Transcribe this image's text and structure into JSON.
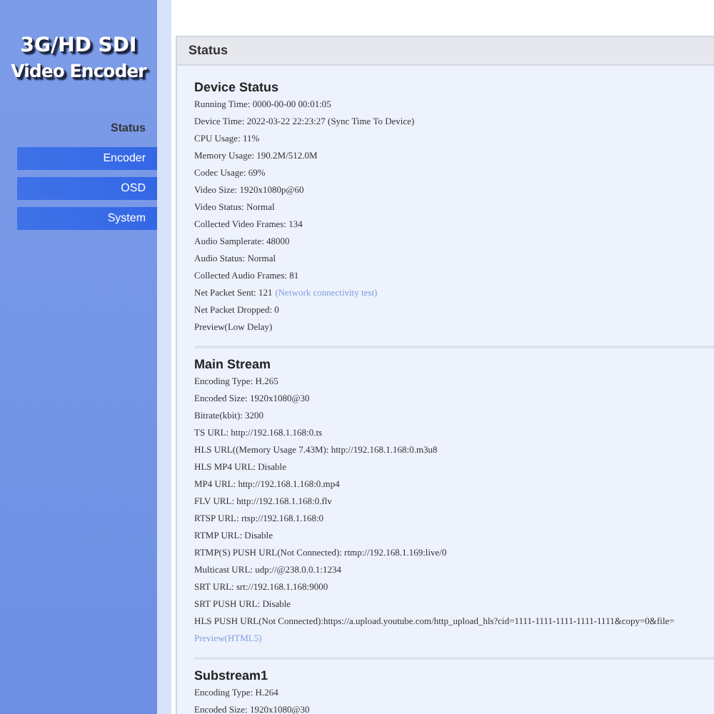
{
  "logo": {
    "line_1": "3G/HD SDI",
    "line_2": "Video Encoder"
  },
  "sidebar": {
    "items": [
      {
        "label": "Status",
        "selected": true
      },
      {
        "label": "Encoder",
        "selected": false
      },
      {
        "label": "OSD",
        "selected": false
      },
      {
        "label": "System",
        "selected": false
      }
    ]
  },
  "panel": {
    "title": "Status",
    "sections": [
      {
        "title": "Device Status",
        "lines": [
          {
            "text": "Running Time: 0000-00-00 00:01:05"
          },
          {
            "text": "Device Time: 2022-03-22 22:23:27 (Sync Time To Device)"
          },
          {
            "text": "CPU Usage: 11%"
          },
          {
            "text": "Memory Usage: 190.2M/512.0M"
          },
          {
            "text": "Codec Usage: 69%"
          },
          {
            "text": "Video Size: 1920x1080p@60"
          },
          {
            "text": "Video Status: Normal"
          },
          {
            "text": "Collected Video Frames: 134"
          },
          {
            "text": "Audio Samplerate: 48000"
          },
          {
            "text": "Audio Status: Normal"
          },
          {
            "text": "Collected Audio Frames: 81"
          },
          {
            "text": "Net Packet Sent: 121",
            "link": "(Network connectivity test)"
          },
          {
            "text": "Net Packet Dropped: 0"
          },
          {
            "text": "Preview(Low Delay)"
          }
        ]
      },
      {
        "title": "Main Stream",
        "lines": [
          {
            "text": "Encoding Type: H.265"
          },
          {
            "text": "Encoded Size: 1920x1080@30"
          },
          {
            "text": "Bitrate(kbit): 3200"
          },
          {
            "text": "TS URL: http://192.168.1.168:0.ts"
          },
          {
            "text": "HLS URL((Memory Usage 7.43M): http://192.168.1.168:0.m3u8"
          },
          {
            "text": "HLS MP4 URL: Disable"
          },
          {
            "text": "MP4 URL: http://192.168.1.168:0.mp4"
          },
          {
            "text": "FLV URL: http://192.168.1.168:0.flv"
          },
          {
            "text": "RTSP URL: rtsp://192.168.1.168:0"
          },
          {
            "text": "RTMP URL: Disable"
          },
          {
            "text": "RTMP(S) PUSH URL(Not Connected): rtmp://192.168.1.169:live/0"
          },
          {
            "text": "Multicast URL: udp://@238.0.0.1:1234"
          },
          {
            "text": "SRT URL: srt://192.168.1.168:9000"
          },
          {
            "text": "SRT PUSH URL: Disable"
          },
          {
            "text": "HLS PUSH URL(Not Connected):https://a.upload.youtube.com/http_upload_hls?cid=1111-1111-1111-1111-1111&copy=0&file="
          },
          {
            "link": "Preview(HTML5)"
          }
        ]
      },
      {
        "title": "Substream1",
        "lines": [
          {
            "text": "Encoding Type: H.264"
          },
          {
            "text": "Encoded Size: 1920x1080@30"
          }
        ]
      }
    ]
  }
}
